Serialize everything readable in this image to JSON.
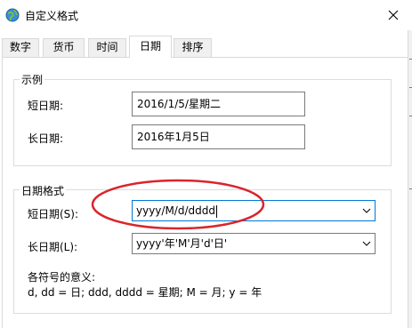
{
  "window": {
    "title": "自定义格式",
    "icon": "globe-icon",
    "close_icon": "close-icon"
  },
  "tabs": [
    {
      "label": "数字",
      "active": false
    },
    {
      "label": "货币",
      "active": false
    },
    {
      "label": "时间",
      "active": false
    },
    {
      "label": "日期",
      "active": true
    },
    {
      "label": "排序",
      "active": false
    }
  ],
  "example": {
    "group_label": "示例",
    "short_label": "短日期:",
    "short_value": "2016/1/5/星期二",
    "long_label": "长日期:",
    "long_value": "2016年1月5日"
  },
  "format": {
    "group_label": "日期格式",
    "short_label": "短日期(S):",
    "short_value": "yyyy/M/d/dddd",
    "long_label": "长日期(L):",
    "long_value": "yyyy'年'M'月'd'日'",
    "legend_title": "各符号的意义:",
    "legend_text": "d, dd = 日;  ddd, dddd = 星期;  M = 月;  y = 年"
  },
  "colors": {
    "annotation": "#d9252b",
    "focus_border": "#0078d7",
    "border": "#7a7a7a"
  }
}
